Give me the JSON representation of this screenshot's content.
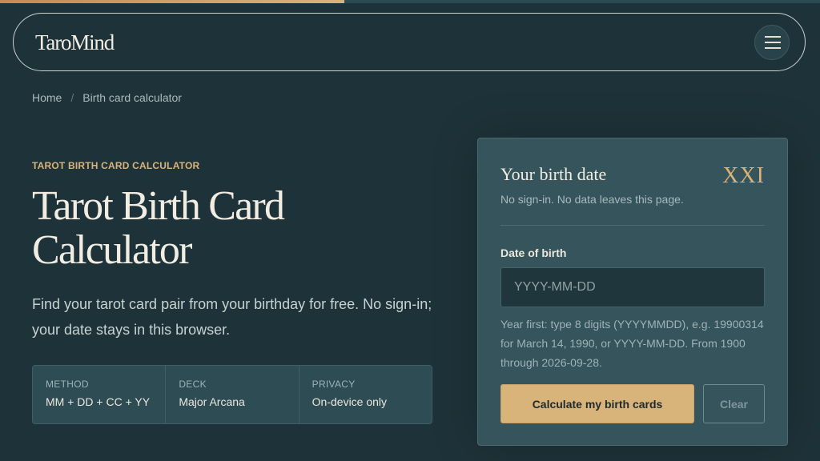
{
  "progress": {
    "fraction": 0.42,
    "color": "#d9b27a"
  },
  "header": {
    "brand": "TaroMind",
    "menu_icon": "hamburger-menu-icon"
  },
  "breadcrumb": {
    "home": "Home",
    "separator": "/",
    "current": "Birth card calculator"
  },
  "hero": {
    "eyebrow": "TAROT BIRTH CARD CALCULATOR",
    "title": "Tarot Birth Card Calculator",
    "description": "Find your tarot card pair from your birthday for free. No sign-in; your date stays in this browser."
  },
  "facts": [
    {
      "label": "METHOD",
      "value": "MM + DD + CC + YY"
    },
    {
      "label": "DECK",
      "value": "Major Arcana"
    },
    {
      "label": "PRIVACY",
      "value": "On-device only"
    }
  ],
  "form": {
    "title": "Your birth date",
    "numeral": "XXI",
    "subtitle": "No sign-in. No data leaves this page.",
    "field_label": "Date of birth",
    "input_value": "",
    "input_placeholder": "YYYY-MM-DD",
    "hint": "Year first: type 8 digits (YYYYMMDD), e.g. 19900314 for March 14, 1990, or YYYY-MM-DD. From 1900 through 2026-09-28.",
    "submit_label": "Calculate my birth cards",
    "clear_label": "Clear"
  },
  "colors": {
    "background": "#1e3239",
    "accent": "#d8b37a",
    "card": "#35545b",
    "text": "#f2ede2"
  }
}
